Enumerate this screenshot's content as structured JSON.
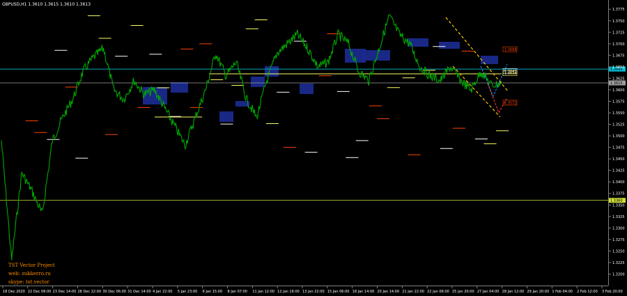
{
  "chart_data": {
    "type": "line",
    "symbol_header": "GBPUSD,H1  1.3610 1.3615 1.3610 1.3613",
    "title": "",
    "xlabel": "",
    "ylabel": "",
    "ylim": [
      1.3175,
      1.3795
    ],
    "y_ticks": [
      "1.3775",
      "1.3750",
      "1.3725",
      "1.3700",
      "1.3675",
      "1.3650",
      "1.3625",
      "1.3600",
      "1.3575",
      "1.3550",
      "1.3525",
      "1.3500",
      "1.3475",
      "1.3450",
      "1.3425",
      "1.3400",
      "1.3375",
      "1.3350",
      "1.3325",
      "1.3300",
      "1.3275",
      "1.3250",
      "1.3225",
      "1.3200"
    ],
    "x_ticks": [
      "18 Dec 2020",
      "22 Dec 06:00",
      "23 Dec 14:00",
      "28 Dec 22:00",
      "30 Dec 06:00",
      "31 Dec 14:00",
      "4 Jan 22:00",
      "5 Jan 23:00",
      "6 Jan 15:00",
      "8 Jan 07:00",
      "11 Jan 12:00",
      "12 Jan 16:00",
      "13 Jan 22:00",
      "15 Jan 06:00",
      "18 Jan 14:00",
      "20 Jan 14:00",
      "21 Jan 22:00",
      "22 Jan 06:00",
      "25 Jan 20:00",
      "27 Jan 04:00",
      "28 Jan 12:00",
      "29 Jan 20:00",
      "1 Feb 04:00",
      "2 Feb 12:00",
      "3 Feb 20:00"
    ],
    "price_series": {
      "name": "GBPUSD H1",
      "color": "#00aa00",
      "x": [
        0,
        2,
        4,
        6,
        8,
        10,
        12,
        14,
        16,
        18,
        20,
        22,
        24,
        26,
        28,
        30,
        32,
        34,
        36,
        38,
        40,
        42,
        44,
        46,
        48,
        50,
        52,
        54,
        56,
        58,
        60,
        62,
        64,
        66,
        68,
        70,
        72,
        74,
        76,
        78,
        80,
        82,
        84,
        86,
        88,
        90,
        92,
        94,
        96,
        98
      ],
      "y": [
        1.349,
        1.323,
        1.342,
        1.338,
        1.333,
        1.349,
        1.354,
        1.358,
        1.364,
        1.367,
        1.369,
        1.36,
        1.358,
        1.362,
        1.359,
        1.36,
        1.356,
        1.352,
        1.348,
        1.354,
        1.36,
        1.368,
        1.363,
        1.366,
        1.358,
        1.354,
        1.362,
        1.368,
        1.37,
        1.372,
        1.369,
        1.365,
        1.366,
        1.372,
        1.37,
        1.364,
        1.362,
        1.369,
        1.376,
        1.372,
        1.37,
        1.365,
        1.363,
        1.362,
        1.365,
        1.362,
        1.36,
        1.364,
        1.361,
        1.3613
      ]
    },
    "horizontal_lines": [
      {
        "price": 1.3645,
        "color": "#00bcd4",
        "label": "1.3645"
      },
      {
        "price": 1.3615,
        "color": "#9e9e9e",
        "label": "1.3615"
      },
      {
        "price": 1.336,
        "color": "#cddc39",
        "label": "1.3360"
      }
    ],
    "price_labels": [
      {
        "price": 1.3688,
        "color": "#ff4500",
        "label": "1.3688"
      },
      {
        "price": 1.3641,
        "color": "#ffffff",
        "label": "1.3641"
      },
      {
        "price": 1.3636,
        "color": "#ffff66",
        "label": "1.3636"
      },
      {
        "price": 1.3572,
        "color": "#ff4500",
        "label": "1.3572"
      }
    ],
    "channel_color": "#ffcc00",
    "forecast_colors": [
      "#1e90ff",
      "#ff3b3b"
    ],
    "zone_color": "#1a2a8c",
    "level_colors": [
      "#ff4500",
      "#ffffff",
      "#ffff66"
    ],
    "grid": false,
    "legend": "none"
  },
  "credits": {
    "line1": "TST Vector Project",
    "line2": "web: zukkerro.ru",
    "line3": "skype: tst.vector"
  }
}
